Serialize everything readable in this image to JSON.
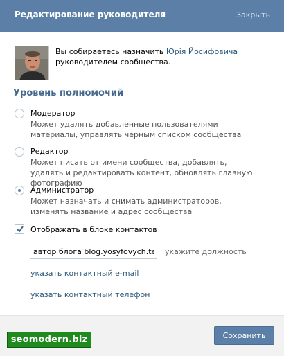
{
  "dialog": {
    "title": "Редактирование руководителя",
    "close_label": "Закрыть"
  },
  "intro": {
    "text_before": "Вы собираетесь назначить ",
    "user_name": "Юрія Йосифовича",
    "text_after": "руководителем сообщества."
  },
  "permissions": {
    "title": "Уровень полномочий",
    "selected": "administrator",
    "options": [
      {
        "id": "moderator",
        "label": "Модератор",
        "description": "Может удалять добавленные пользователями материалы, управлять чёрным списком сообщества"
      },
      {
        "id": "editor",
        "label": "Редактор",
        "description": "Может писать от имени сообщества, добавлять, удалять и редактировать контент, обновлять главную фотографию"
      },
      {
        "id": "administrator",
        "label": "Администратор",
        "description": "Может назначать и снимать администраторов, изменять название и адрес сообщества"
      }
    ]
  },
  "contacts": {
    "checkbox_label": "Отображать в блоке контактов",
    "checked": true,
    "position_value": "автор блога blog.yosyfovych.te.ua",
    "position_hint": "укажите должность",
    "email_link": "указать контактный e-mail",
    "phone_link": "указать контактный телефон"
  },
  "footer": {
    "save_label": "Сохранить"
  },
  "watermark": {
    "text": "seomodern.biz"
  },
  "colors": {
    "header_bg": "#5b7fa6",
    "accent_text": "#45688e",
    "link": "#2b587a",
    "watermark_bg": "#1f8b1f"
  }
}
